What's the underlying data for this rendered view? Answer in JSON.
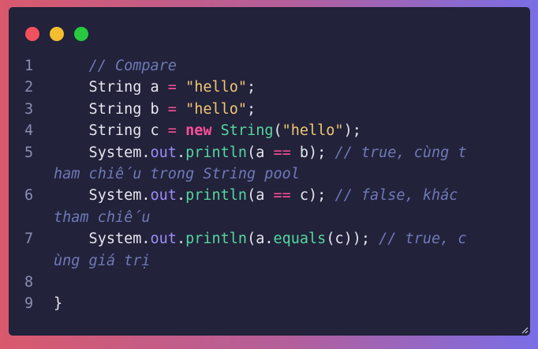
{
  "colors": {
    "dot_close": "#f0515d",
    "dot_minimize": "#f4bf2e",
    "dot_maximize": "#27c93f"
  },
  "lines": [
    {
      "num": "1",
      "tokens": [
        {
          "t": "    ",
          "c": "plain"
        },
        {
          "t": "// Compare",
          "c": "cmt"
        }
      ]
    },
    {
      "num": "2",
      "tokens": [
        {
          "t": "    String a ",
          "c": "plain"
        },
        {
          "t": "=",
          "c": "op"
        },
        {
          "t": " ",
          "c": "plain"
        },
        {
          "t": "\"hello\"",
          "c": "str"
        },
        {
          "t": ";",
          "c": "plain"
        }
      ]
    },
    {
      "num": "3",
      "tokens": [
        {
          "t": "    String b ",
          "c": "plain"
        },
        {
          "t": "=",
          "c": "op"
        },
        {
          "t": " ",
          "c": "plain"
        },
        {
          "t": "\"hello\"",
          "c": "str"
        },
        {
          "t": ";",
          "c": "plain"
        }
      ]
    },
    {
      "num": "4",
      "tokens": [
        {
          "t": "    String c ",
          "c": "plain"
        },
        {
          "t": "=",
          "c": "op"
        },
        {
          "t": " ",
          "c": "plain"
        },
        {
          "t": "new",
          "c": "kw"
        },
        {
          "t": " ",
          "c": "plain"
        },
        {
          "t": "String",
          "c": "cls"
        },
        {
          "t": "(",
          "c": "plain"
        },
        {
          "t": "\"hello\"",
          "c": "str"
        },
        {
          "t": ");",
          "c": "plain"
        }
      ]
    },
    {
      "num": "5",
      "tokens": [
        {
          "t": "    System.",
          "c": "plain"
        },
        {
          "t": "out",
          "c": "prop"
        },
        {
          "t": ".",
          "c": "plain"
        },
        {
          "t": "println",
          "c": "fn"
        },
        {
          "t": "(a ",
          "c": "plain"
        },
        {
          "t": "==",
          "c": "op"
        },
        {
          "t": " b); ",
          "c": "plain"
        },
        {
          "t": "// true, cùng t",
          "c": "cmt"
        }
      ]
    },
    {
      "num": "",
      "tokens": [
        {
          "t": "ham chiếu trong String pool",
          "c": "cmt"
        }
      ]
    },
    {
      "num": "6",
      "tokens": [
        {
          "t": "    System.",
          "c": "plain"
        },
        {
          "t": "out",
          "c": "prop"
        },
        {
          "t": ".",
          "c": "plain"
        },
        {
          "t": "println",
          "c": "fn"
        },
        {
          "t": "(a ",
          "c": "plain"
        },
        {
          "t": "==",
          "c": "op"
        },
        {
          "t": " c); ",
          "c": "plain"
        },
        {
          "t": "// false, khác",
          "c": "cmt"
        }
      ]
    },
    {
      "num": "",
      "tokens": [
        {
          "t": "tham chiếu",
          "c": "cmt"
        }
      ]
    },
    {
      "num": "7",
      "tokens": [
        {
          "t": "    System.",
          "c": "plain"
        },
        {
          "t": "out",
          "c": "prop"
        },
        {
          "t": ".",
          "c": "plain"
        },
        {
          "t": "println",
          "c": "fn"
        },
        {
          "t": "(a.",
          "c": "plain"
        },
        {
          "t": "equals",
          "c": "fn"
        },
        {
          "t": "(c)); ",
          "c": "plain"
        },
        {
          "t": "// true, c",
          "c": "cmt"
        }
      ]
    },
    {
      "num": "",
      "tokens": [
        {
          "t": "ùng giá trị",
          "c": "cmt"
        }
      ]
    },
    {
      "num": "8",
      "tokens": []
    },
    {
      "num": "9",
      "tokens": [
        {
          "t": "}",
          "c": "plain"
        }
      ]
    }
  ]
}
